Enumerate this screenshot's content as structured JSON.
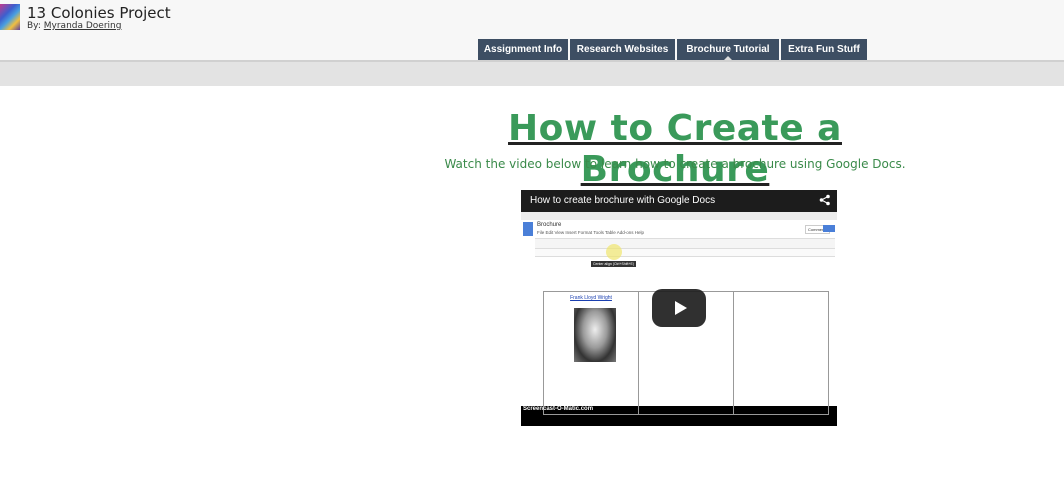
{
  "site": {
    "title": "13 Colonies Project",
    "by_prefix": "By:",
    "author": "Myranda Doering"
  },
  "nav": {
    "tabs": [
      {
        "label": "Assignment Info",
        "active": false
      },
      {
        "label": "Research Websites",
        "active": false
      },
      {
        "label": "Brochure Tutorial",
        "active": true
      },
      {
        "label": "Extra Fun Stuff",
        "active": false
      }
    ]
  },
  "main": {
    "heading": "How to Create a Brochure",
    "subtext": "Watch the video below to learn how to create a brochure using Google Docs."
  },
  "video": {
    "title": "How to create brochure with Google Docs",
    "share_icon": "share-icon",
    "play_icon": "play-icon",
    "doc_name": "Brochure",
    "menu": "File  Edit  View  Insert  Format  Tools  Table  Add-ons  Help",
    "comments_label": "Comments",
    "link_text": "Frank Lloyd Wright",
    "watermark": "Screencast-O-Matic.com"
  },
  "colors": {
    "nav_bg": "#3d4e63",
    "heading": "#3a9a5a"
  }
}
